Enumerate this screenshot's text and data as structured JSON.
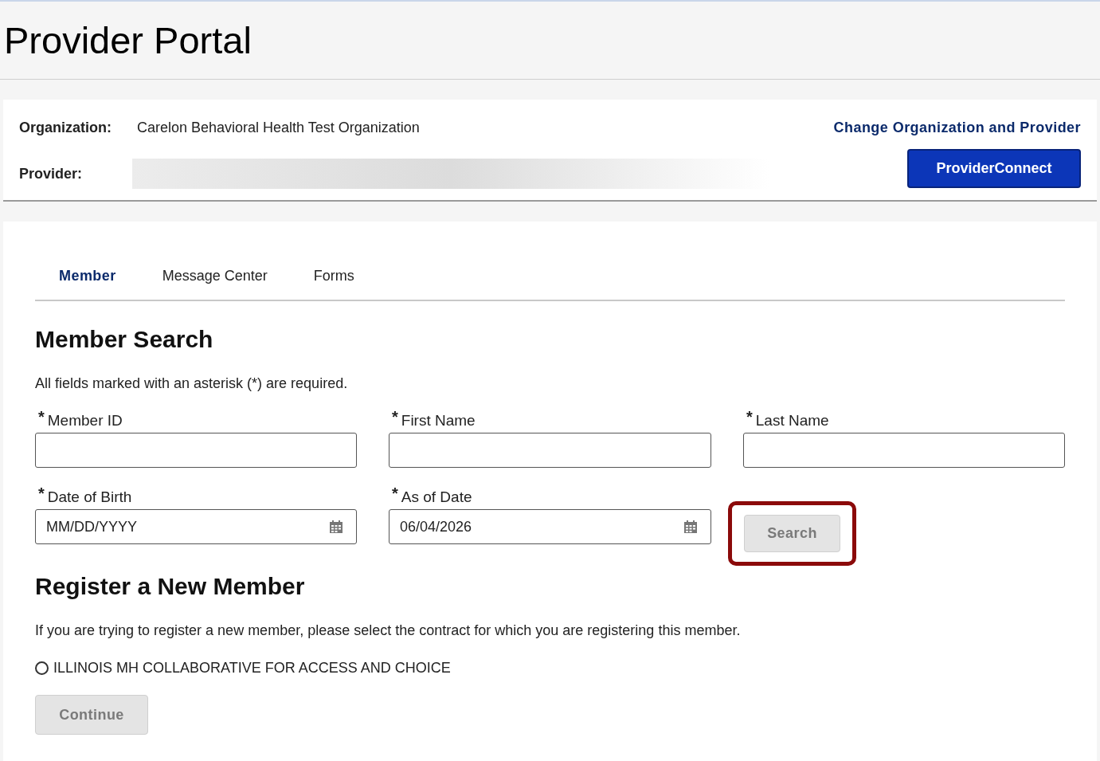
{
  "header": {
    "title": "Provider Portal"
  },
  "context": {
    "organization_label": "Organization:",
    "organization": "Carelon Behavioral Health Test Organization",
    "provider_label": "Provider:",
    "change_link": "Change Organization and Provider",
    "connect_button": "ProviderConnect"
  },
  "tabs": [
    {
      "label": "Member",
      "selected": true
    },
    {
      "label": "Message Center",
      "selected": false
    },
    {
      "label": "Forms",
      "selected": false
    }
  ],
  "member_search": {
    "heading": "Member Search",
    "note": "All fields marked with an asterisk (*) are required.",
    "fields": [
      {
        "label": "Member ID",
        "required_mark": "*",
        "kind": "text"
      },
      {
        "label": "First Name",
        "required_mark": "*",
        "kind": "text"
      },
      {
        "label": "Last Name",
        "required_mark": "*",
        "kind": "text"
      },
      {
        "label": "Date of Birth",
        "required_mark": "*",
        "kind": "date",
        "placeholder": "MM/DD/YYYY"
      },
      {
        "label": "As of Date",
        "required_mark": "*",
        "kind": "date",
        "value": "06/04/2026"
      }
    ],
    "search_button": {
      "label": "Search",
      "disabled": true,
      "highlighted": true
    }
  },
  "register": {
    "heading": "Register a New Member",
    "note": "If you are trying to register a new member, please select the contract for which you are registering this member.",
    "contracts": [
      {
        "label": "ILLINOIS MH COLLABORATIVE FOR ACCESS AND CHOICE",
        "selected": false
      }
    ],
    "continue_button": {
      "label": "Continue",
      "disabled": true
    }
  }
}
